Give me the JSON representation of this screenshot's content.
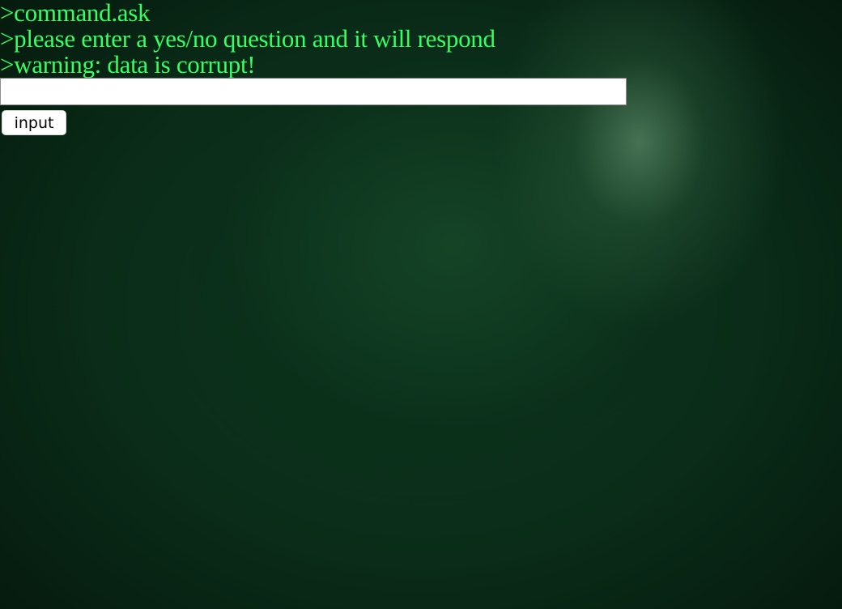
{
  "terminal": {
    "lines": [
      ">command.ask",
      ">please enter a yes/no question and it will respond",
      ">warning: data is corrupt!"
    ]
  },
  "form": {
    "question_value": "",
    "question_placeholder": "",
    "submit_label": "input"
  },
  "colors": {
    "terminal_text": "#33ff66",
    "background": "#0a2c18"
  }
}
